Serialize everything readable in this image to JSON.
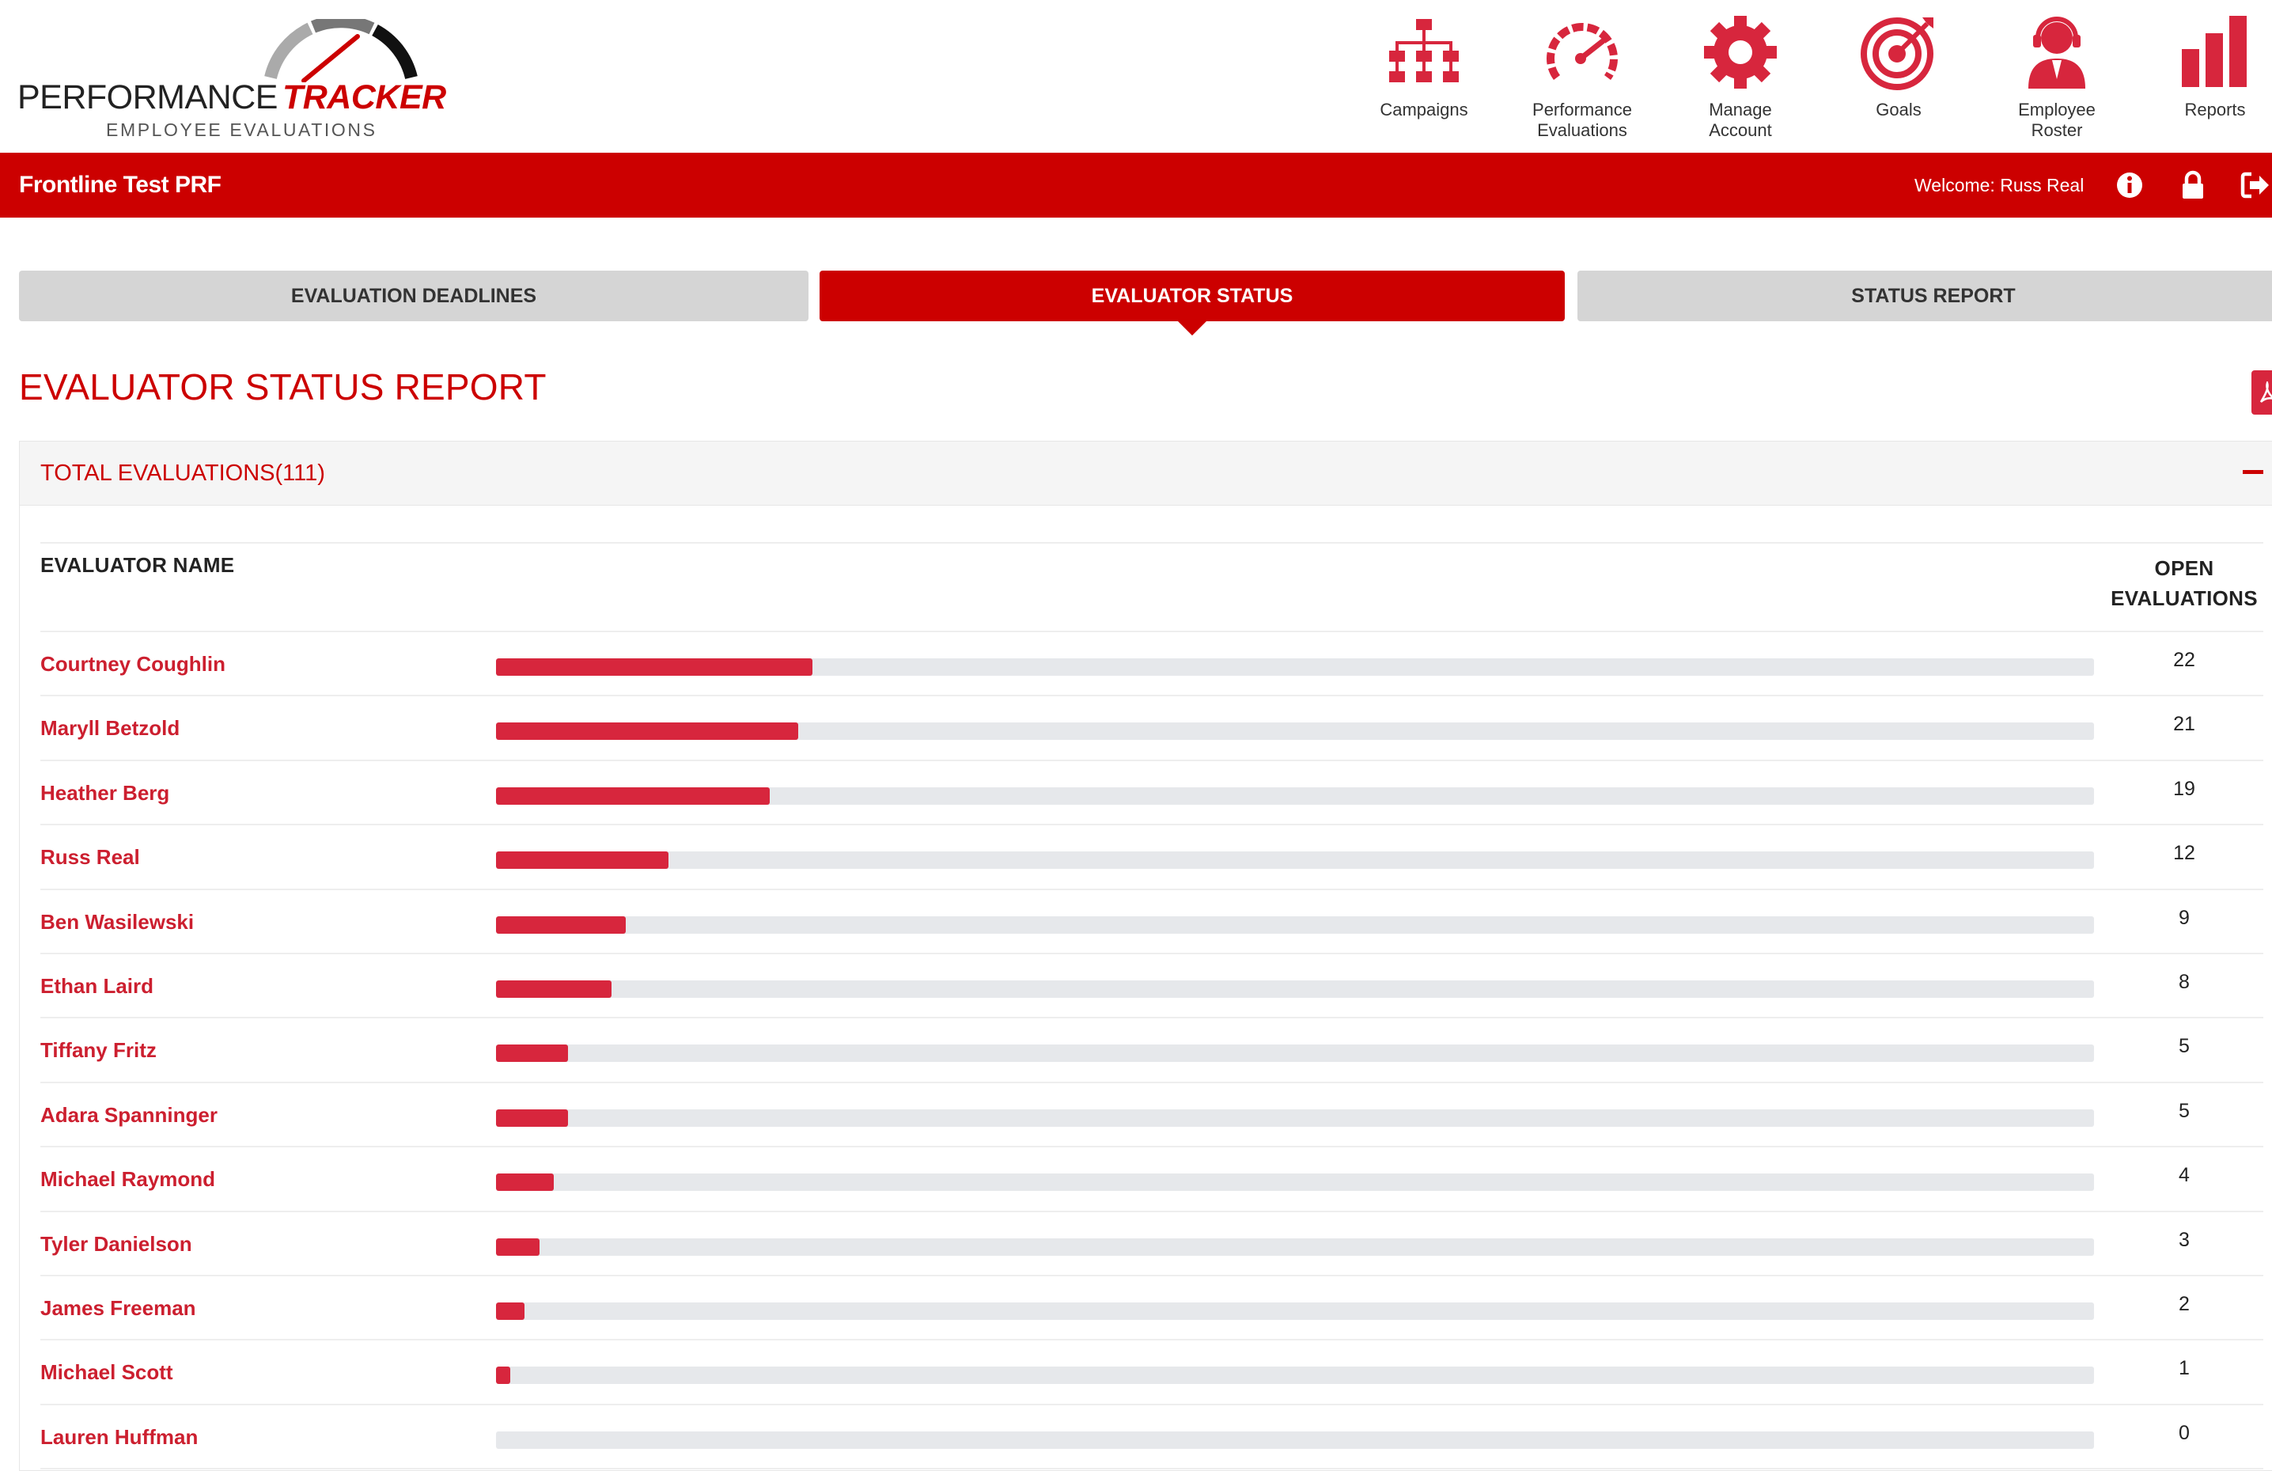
{
  "logo": {
    "brand_left": "PERFORMANCE",
    "brand_right": "TRACKER",
    "subtitle": "EMPLOYEE EVALUATIONS"
  },
  "nav": [
    {
      "label": "Campaigns",
      "icon": "org-chart-icon"
    },
    {
      "label": "Performance\nEvaluations",
      "icon": "speedometer-icon"
    },
    {
      "label": "Manage\nAccount",
      "icon": "gear-icon"
    },
    {
      "label": "Goals",
      "icon": "target-icon"
    },
    {
      "label": "Employee\nRoster",
      "icon": "headset-person-icon"
    },
    {
      "label": "Reports",
      "icon": "bar-chart-icon"
    }
  ],
  "topbar": {
    "app_name": "Frontline Test PRF",
    "welcome": "Welcome: Russ Real",
    "icons": [
      "info-icon",
      "lock-icon",
      "logout-icon"
    ]
  },
  "tabs": [
    {
      "label": "EVALUATION DEADLINES",
      "active": false
    },
    {
      "label": "EVALUATOR STATUS",
      "active": true
    },
    {
      "label": "STATUS REPORT",
      "active": false
    }
  ],
  "page_title": "EVALUATOR STATUS REPORT",
  "panel": {
    "title": "TOTAL EVALUATIONS(111)",
    "col_name": "EVALUATOR NAME",
    "col_open": "OPEN\nEVALUATIONS"
  },
  "colors": {
    "brand_red": "#cc0000",
    "bar_fill": "#d7263d",
    "bar_track": "#e6e8eb"
  },
  "rows": [
    {
      "name": "Courtney Coughlin",
      "open": 22
    },
    {
      "name": "Maryll Betzold",
      "open": 21
    },
    {
      "name": "Heather Berg",
      "open": 19
    },
    {
      "name": "Russ Real",
      "open": 12
    },
    {
      "name": "Ben Wasilewski",
      "open": 9
    },
    {
      "name": "Ethan Laird",
      "open": 8
    },
    {
      "name": "Tiffany Fritz",
      "open": 5
    },
    {
      "name": "Adara Spanninger",
      "open": 5
    },
    {
      "name": "Michael Raymond",
      "open": 4
    },
    {
      "name": "Tyler Danielson",
      "open": 3
    },
    {
      "name": "James Freeman",
      "open": 2
    },
    {
      "name": "Michael Scott",
      "open": 1
    },
    {
      "name": "Lauren Huffman",
      "open": 0
    }
  ],
  "bar_scale_max": 111
}
